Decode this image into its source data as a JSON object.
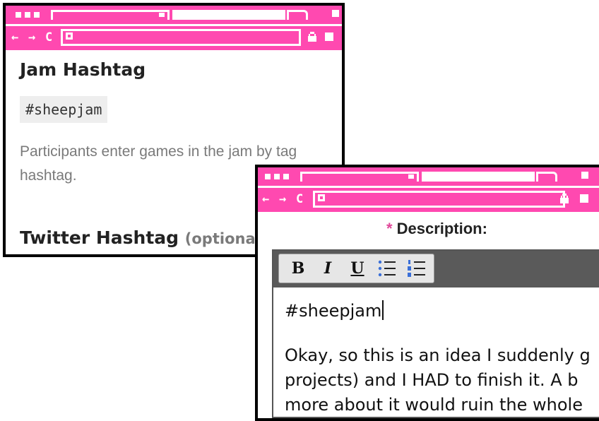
{
  "colors": {
    "chrome": "#ff49b0",
    "border": "#000000",
    "required_star": "#e0489a"
  },
  "browser": {
    "nav_back": "←",
    "nav_forward": "→",
    "nav_reload": "C"
  },
  "jam_page": {
    "heading": "Jam Hashtag",
    "hashtag": "#sheepjam",
    "help_text": "Participants enter games in the jam by tag",
    "help_text_2": "hashtag.",
    "twitter_heading": "Twitter Hashtag",
    "twitter_optional": "(optional)"
  },
  "form": {
    "required_mark": "*",
    "description_label": "Description:",
    "toolbar": {
      "bold": "B",
      "italic": "I",
      "underline": "U",
      "bullet_list_icon": "bullet-list-icon",
      "numbered_list_icon": "numbered-list-icon"
    },
    "editor_lines": [
      "#sheepjam",
      "Okay, so this is an idea I suddenly g",
      "projects) and I HAD to finish it. A b",
      "more about it would ruin the whole"
    ]
  }
}
